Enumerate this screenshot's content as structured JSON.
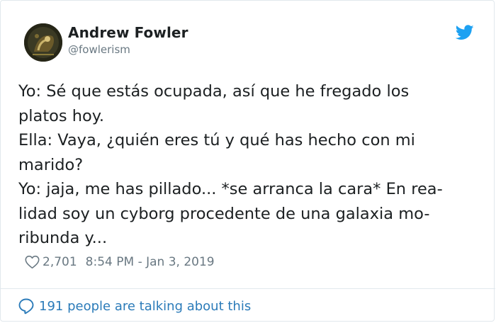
{
  "author": {
    "name": "Andrew Fowler",
    "handle": "@fowlerism"
  },
  "tweet": {
    "lines": [
      "Yo: Sé que estás ocupada, así que he fregado los",
      "platos hoy.",
      "Ella: Vaya, ¿quién eres tú y qué has hecho con mi",
      "marido?",
      "Yo: jaja, me has pillado... *se arranca la cara* En rea-",
      "lidad soy un cyborg procedente de una galaxia mo-",
      "ribunda y..."
    ]
  },
  "meta": {
    "likes": "2,701",
    "timestamp": "8:54 PM - Jan 3, 2019"
  },
  "footer": {
    "conversation_text": "191 people are talking about this"
  },
  "icons": {
    "brand": "twitter-bird-icon",
    "like": "heart-icon",
    "conversation": "speech-bubble-icon"
  },
  "colors": {
    "brand_blue": "#1da1f2",
    "link_blue": "#2b7bb9",
    "muted_text": "#697882",
    "border": "#e1e8ed"
  }
}
